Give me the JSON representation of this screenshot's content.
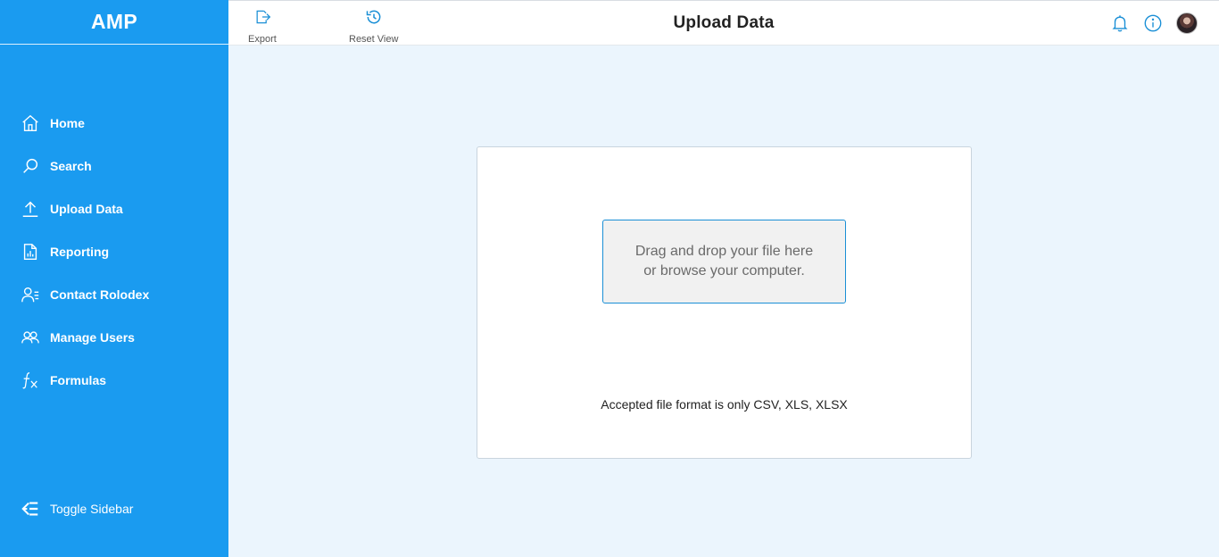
{
  "brand": "AMP",
  "header": {
    "title": "Upload Data",
    "tools": [
      {
        "label": "Export",
        "icon": "export-icon"
      },
      {
        "label": "Reset View",
        "icon": "history-icon"
      }
    ],
    "icons": [
      "bell-icon",
      "info-icon",
      "avatar"
    ]
  },
  "sidebar": {
    "items": [
      {
        "label": "Home",
        "icon": "home-icon"
      },
      {
        "label": "Search",
        "icon": "search-icon"
      },
      {
        "label": "Upload Data",
        "icon": "upload-icon"
      },
      {
        "label": "Reporting",
        "icon": "report-icon"
      },
      {
        "label": "Contact Rolodex",
        "icon": "contact-icon"
      },
      {
        "label": "Manage Users",
        "icon": "users-icon"
      },
      {
        "label": "Formulas",
        "icon": "formula-icon"
      }
    ],
    "toggle_label": "Toggle Sidebar"
  },
  "upload": {
    "drop_line1": "Drag and drop your file here",
    "drop_line2": "or browse your computer.",
    "formats_text": "Accepted file format is only CSV, XLS, XLSX"
  },
  "colors": {
    "sidebar": "#1a9bf0",
    "accent": "#1a8fd6",
    "background": "#ebf5fd"
  }
}
